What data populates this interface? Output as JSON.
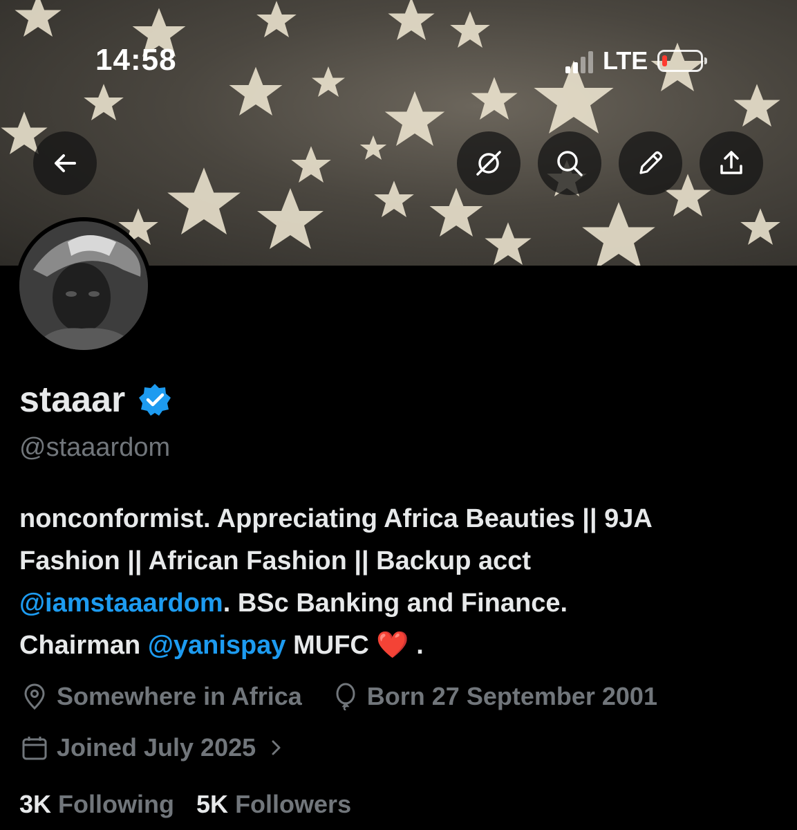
{
  "status_bar": {
    "time": "14:58",
    "network": "LTE",
    "battery_level": 0.1,
    "battery_color": "#ff3b30"
  },
  "header": {
    "back_icon": "arrow-left-icon",
    "actions": [
      "grok-icon",
      "search-icon",
      "edit-pencil-icon",
      "share-icon"
    ]
  },
  "profile": {
    "name": "staaar",
    "verified": true,
    "verified_color": "#1d9bf0",
    "handle": "@staaardom",
    "bio": {
      "line1": "nonconformist. Appreciating Africa Beauties || 9JA",
      "line2": "Fashion || African Fashion || Backup acct",
      "mention1": "@iamstaaardom",
      "after_mention1": ". BSc Banking and Finance.",
      "line4_prefix": "Chairman ",
      "mention2": "@yanispay",
      "line4_suffix": " MUFC ",
      "emoji": "❤️",
      "end": " ."
    },
    "location": "Somewhere in Africa",
    "birthday": "Born 27 September 2001",
    "joined": "Joined July 2025",
    "following_count": "3K",
    "following_label": "Following",
    "followers_count": "5K",
    "followers_label": "Followers"
  },
  "colors": {
    "background": "#000000",
    "text": "#e7e9ea",
    "muted": "#71767b",
    "link": "#1d9bf0"
  }
}
